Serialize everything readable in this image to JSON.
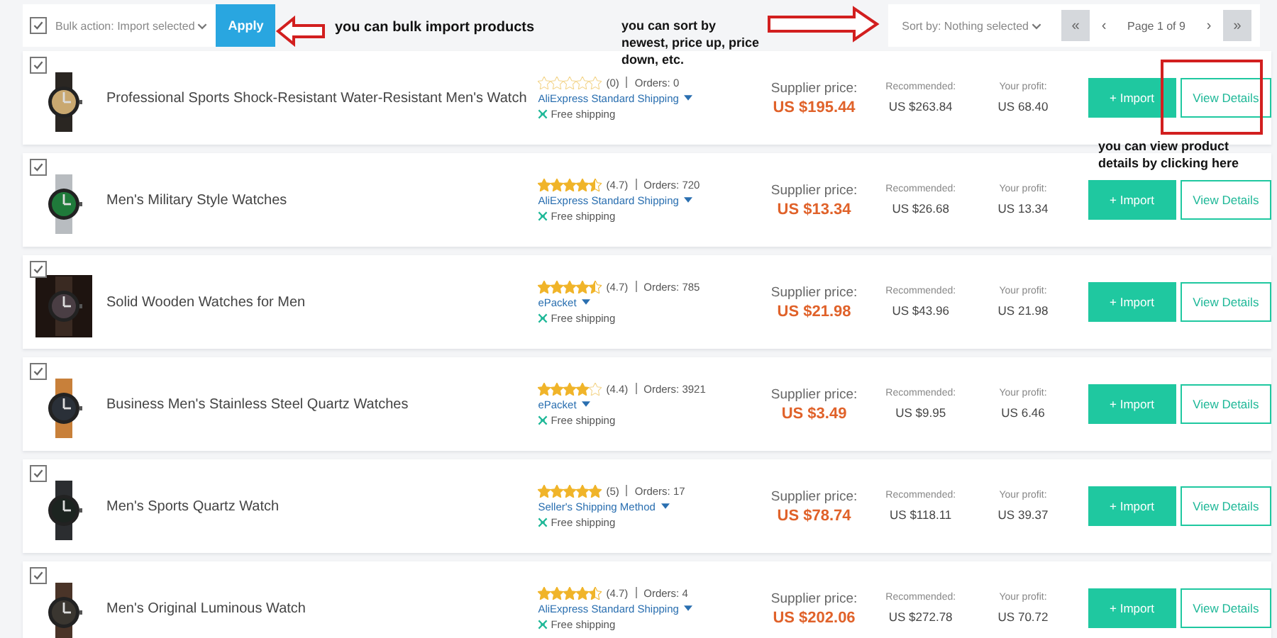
{
  "toolbar": {
    "bulk_checked": true,
    "bulk_action": "Bulk action: Import selected",
    "apply": "Apply",
    "sort": "Sort by: Nothing selected",
    "pager": {
      "first": "«",
      "prev": "‹",
      "page": "Page 1 of 9",
      "next": "›",
      "last": "»"
    }
  },
  "products": [
    {
      "checked": true,
      "title": "Professional Sports Shock-Resistant Water-Resistant Men's Watch",
      "stars": 0,
      "rating": "(0)",
      "orders": "Orders: 0",
      "shipping": "AliExpress Standard Shipping",
      "free_shipping": "Free shipping",
      "supplier_label": "Supplier price:",
      "supplier_price": "US $195.44",
      "recommended_label": "Recommended:",
      "recommended": "US $263.84",
      "profit_label": "Your profit:",
      "profit": "US 68.40",
      "import": "+ Import",
      "details": "View Details"
    },
    {
      "checked": true,
      "title": "Men's Military Style Watches",
      "stars": 4.5,
      "rating": "(4.7)",
      "orders": "Orders: 720",
      "shipping": "AliExpress Standard Shipping",
      "free_shipping": "Free shipping",
      "supplier_label": "Supplier price:",
      "supplier_price": "US $13.34",
      "recommended_label": "Recommended:",
      "recommended": "US $26.68",
      "profit_label": "Your profit:",
      "profit": "US 13.34",
      "import": "+ Import",
      "details": "View Details"
    },
    {
      "checked": true,
      "title": "Solid Wooden Watches for Men",
      "stars": 4.5,
      "rating": "(4.7)",
      "orders": "Orders: 785",
      "shipping": "ePacket",
      "free_shipping": "Free shipping",
      "supplier_label": "Supplier price:",
      "supplier_price": "US $21.98",
      "recommended_label": "Recommended:",
      "recommended": "US $43.96",
      "profit_label": "Your profit:",
      "profit": "US 21.98",
      "import": "+ Import",
      "details": "View Details"
    },
    {
      "checked": true,
      "title": "Business Men's Stainless Steel Quartz Watches",
      "stars": 4,
      "rating": "(4.4)",
      "orders": "Orders: 3921",
      "shipping": "ePacket",
      "free_shipping": "Free shipping",
      "supplier_label": "Supplier price:",
      "supplier_price": "US $3.49",
      "recommended_label": "Recommended:",
      "recommended": "US $9.95",
      "profit_label": "Your profit:",
      "profit": "US 6.46",
      "import": "+ Import",
      "details": "View Details"
    },
    {
      "checked": true,
      "title": "Men's Sports Quartz Watch",
      "stars": 5,
      "rating": "(5)",
      "orders": "Orders: 17",
      "shipping": "Seller's Shipping Method",
      "free_shipping": "Free shipping",
      "supplier_label": "Supplier price:",
      "supplier_price": "US $78.74",
      "recommended_label": "Recommended:",
      "recommended": "US $118.11",
      "profit_label": "Your profit:",
      "profit": "US 39.37",
      "import": "+ Import",
      "details": "View Details"
    },
    {
      "checked": true,
      "title": "Men's Original Luminous Watch",
      "stars": 4.5,
      "rating": "(4.7)",
      "orders": "Orders: 4",
      "shipping": "AliExpress Standard Shipping",
      "free_shipping": "Free shipping",
      "supplier_label": "Supplier price:",
      "supplier_price": "US $202.06",
      "recommended_label": "Recommended:",
      "recommended": "US $272.78",
      "profit_label": "Your profit:",
      "profit": "US 70.72",
      "import": "+ Import",
      "details": "View Details"
    }
  ],
  "annotations": [
    {
      "text": "you can bulk import products"
    },
    {
      "text": "you can sort by newest, price up, price down, etc."
    },
    {
      "text": "you can view product details by clicking here"
    }
  ]
}
